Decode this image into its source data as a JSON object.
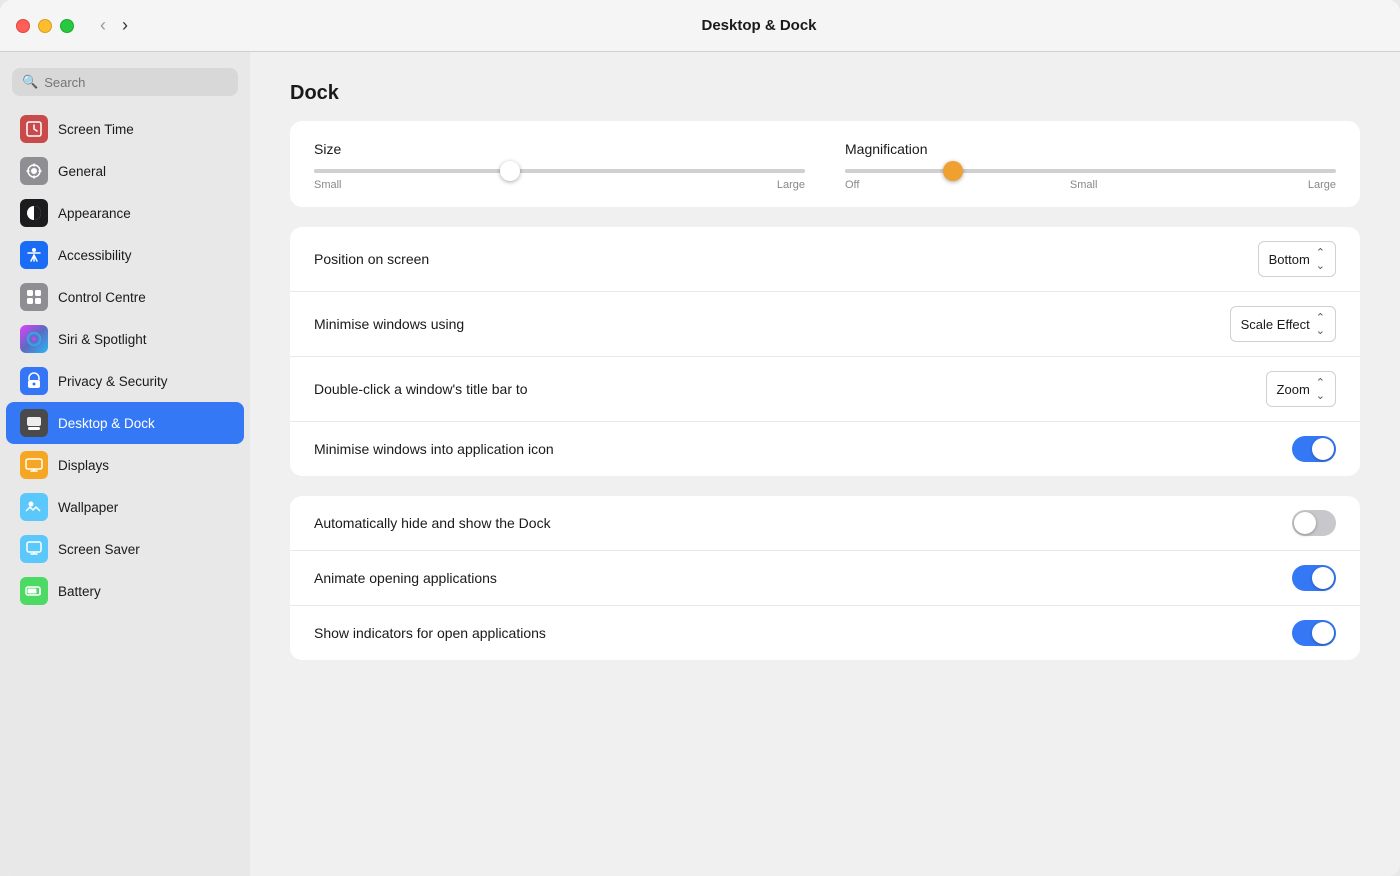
{
  "window": {
    "title": "Desktop & Dock"
  },
  "traffic_lights": {
    "close": "close",
    "minimize": "minimize",
    "maximize": "maximize"
  },
  "nav": {
    "back_label": "‹",
    "forward_label": "›"
  },
  "sidebar": {
    "search_placeholder": "Search",
    "items": [
      {
        "id": "screen-time",
        "label": "Screen Time",
        "icon": "⏱",
        "icon_class": "icon-screen-time",
        "active": false
      },
      {
        "id": "general",
        "label": "General",
        "icon": "⚙",
        "icon_class": "icon-general",
        "active": false
      },
      {
        "id": "appearance",
        "label": "Appearance",
        "icon": "◑",
        "icon_class": "icon-appearance",
        "active": false
      },
      {
        "id": "accessibility",
        "label": "Accessibility",
        "icon": "♿",
        "icon_class": "icon-accessibility",
        "active": false
      },
      {
        "id": "control-centre",
        "label": "Control Centre",
        "icon": "▦",
        "icon_class": "icon-control-centre",
        "active": false
      },
      {
        "id": "siri",
        "label": "Siri & Spotlight",
        "icon": "◉",
        "icon_class": "icon-siri",
        "active": false
      },
      {
        "id": "privacy",
        "label": "Privacy & Security",
        "icon": "✋",
        "icon_class": "icon-privacy",
        "active": false
      },
      {
        "id": "desktop-dock",
        "label": "Desktop & Dock",
        "icon": "▬",
        "icon_class": "icon-desktop-dock",
        "active": true
      },
      {
        "id": "displays",
        "label": "Displays",
        "icon": "☀",
        "icon_class": "icon-displays",
        "active": false
      },
      {
        "id": "wallpaper",
        "label": "Wallpaper",
        "icon": "❋",
        "icon_class": "icon-wallpaper",
        "active": false
      },
      {
        "id": "screen-saver",
        "label": "Screen Saver",
        "icon": "▤",
        "icon_class": "icon-screen-saver",
        "active": false
      },
      {
        "id": "battery",
        "label": "Battery",
        "icon": "▬",
        "icon_class": "icon-battery",
        "active": false
      }
    ]
  },
  "main": {
    "section_title": "Dock",
    "sliders": {
      "size": {
        "label": "Size",
        "min_label": "Small",
        "max_label": "Large",
        "value_percent": 40
      },
      "magnification": {
        "label": "Magnification",
        "min_label": "Off",
        "min_label2": "Small",
        "max_label": "Large",
        "value_percent": 22
      }
    },
    "settings": [
      {
        "id": "position-on-screen",
        "label": "Position on screen",
        "type": "dropdown",
        "value": "Bottom"
      },
      {
        "id": "minimise-windows-using",
        "label": "Minimise windows using",
        "type": "dropdown",
        "value": "Scale Effect"
      },
      {
        "id": "double-click-title-bar",
        "label": "Double-click a window's title bar to",
        "type": "dropdown",
        "value": "Zoom"
      },
      {
        "id": "minimise-into-icon",
        "label": "Minimise windows into application icon",
        "type": "toggle",
        "value": true
      },
      {
        "id": "auto-hide-dock",
        "label": "Automatically hide and show the Dock",
        "type": "toggle",
        "value": false
      },
      {
        "id": "animate-opening",
        "label": "Animate opening applications",
        "type": "toggle",
        "value": true
      },
      {
        "id": "show-indicators",
        "label": "Show indicators for open applications",
        "type": "toggle",
        "value": true
      }
    ]
  }
}
